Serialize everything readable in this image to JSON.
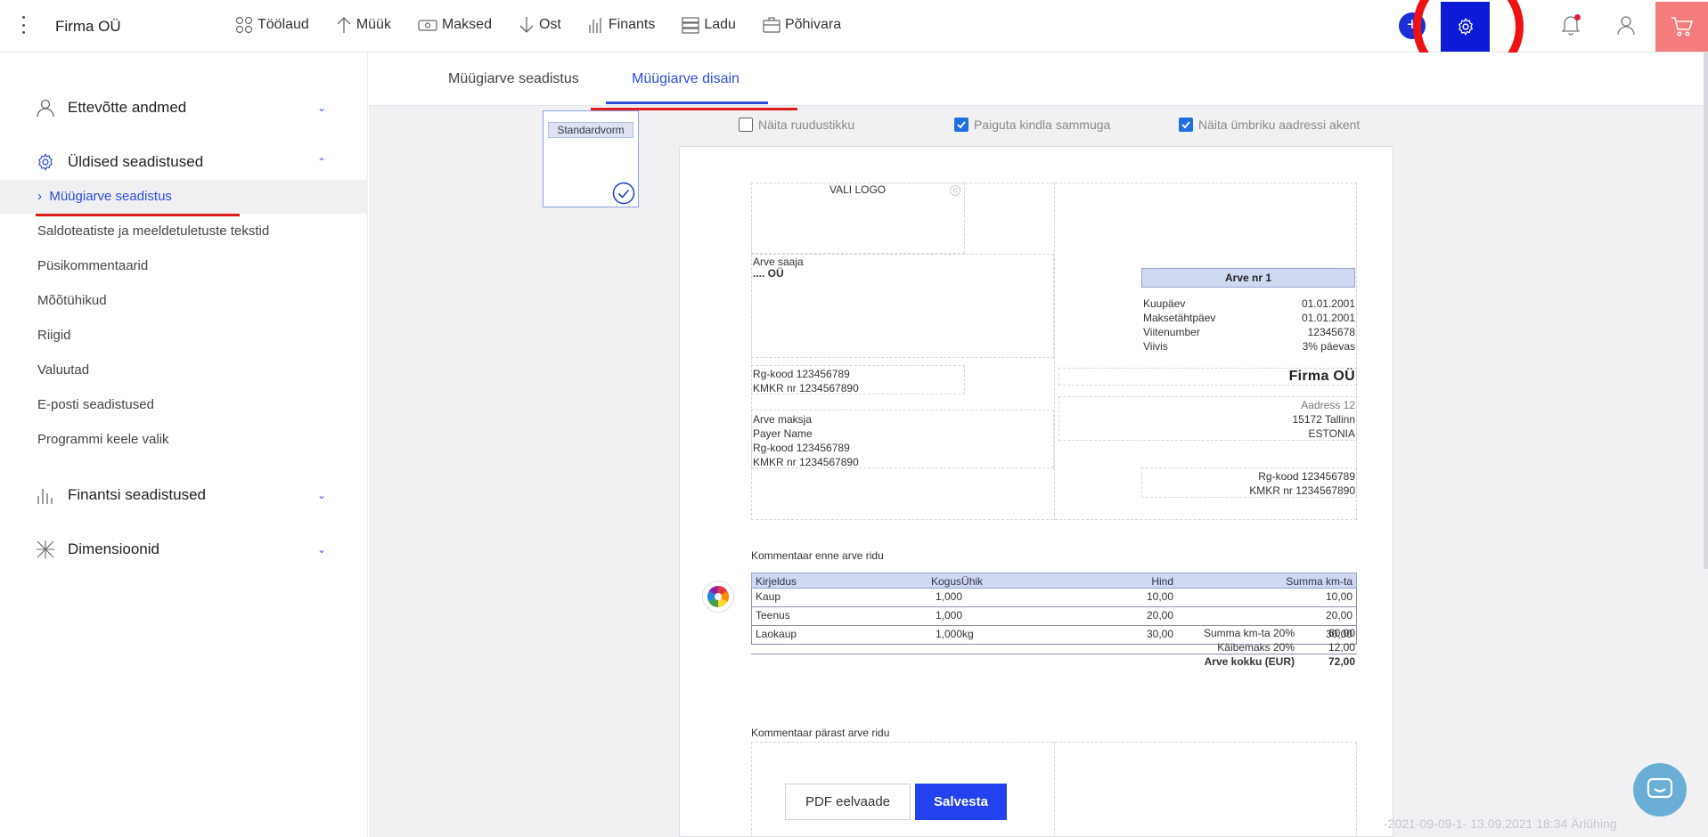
{
  "header": {
    "company": "Firma OÜ",
    "nav": [
      {
        "label": "Töölaud",
        "icon": "dashboard-icon"
      },
      {
        "label": "Müük",
        "icon": "arrow-up-icon"
      },
      {
        "label": "Maksed",
        "icon": "money-icon"
      },
      {
        "label": "Ost",
        "icon": "arrow-down-icon"
      },
      {
        "label": "Finants",
        "icon": "bar-chart-icon"
      },
      {
        "label": "Ladu",
        "icon": "warehouse-icon"
      },
      {
        "label": "Põhivara",
        "icon": "briefcase-icon"
      }
    ],
    "plus": "+"
  },
  "sidebar": {
    "sections": [
      {
        "label": "Ettevõtte andmed",
        "icon": "person-icon",
        "expanded": false
      },
      {
        "label": "Üldised seadistused",
        "icon": "gear-icon",
        "expanded": true
      },
      {
        "label": "Finantsi seadistused",
        "icon": "bar-chart-icon",
        "expanded": false
      },
      {
        "label": "Dimensioonid",
        "icon": "dimensions-icon",
        "expanded": false
      }
    ],
    "items": [
      "Müügiarve seadistus",
      "Saldoteatiste ja meeldetuletuste tekstid",
      "Püsikommentaarid",
      "Mõõtühikud",
      "Riigid",
      "Valuutad",
      "E-posti seadistused",
      "Programmi keele valik"
    ],
    "active_item": "Müügiarve seadistus"
  },
  "tabs": [
    "Müügiarve seadistus",
    "Müügiarve disain"
  ],
  "active_tab": "Müügiarve disain",
  "template": {
    "label": "Standardvorm"
  },
  "options": [
    {
      "label": "Näita ruudustikku",
      "checked": false
    },
    {
      "label": "Paiguta kindla sammuga",
      "checked": true
    },
    {
      "label": "Näita ümbriku aadressi akent",
      "checked": true
    }
  ],
  "invoice": {
    "logo": "VALI LOGO",
    "recipient_label": "Arve saaja",
    "recipient_name": "....  OÜ",
    "recipient_reg": "Rg-kood 123456789",
    "recipient_vat": "KMKR nr 1234567890",
    "payer_label": "Arve maksja",
    "payer_name": "Payer Name",
    "payer_reg": "Rg-kood 123456789",
    "payer_vat": "KMKR nr 1234567890",
    "invoice_title": "Arve nr 1",
    "details": [
      {
        "label": "Kuupäev",
        "value": "01.01.2001"
      },
      {
        "label": "Maksetähtpäev",
        "value": "01.01.2001"
      },
      {
        "label": "Viitenumber",
        "value": "12345678"
      },
      {
        "label": "Viivis",
        "value": "3% päevas"
      }
    ],
    "seller_name": "Firma OÜ",
    "seller_address": [
      "Aadress 12",
      "15172 Tallinn",
      "ESTONIA"
    ],
    "seller_reg": "Rg-kood 123456789",
    "seller_vat": "KMKR nr 1234567890",
    "comment_before": "Kommentaar enne arve ridu",
    "columns": [
      "Kirjeldus",
      "KogusÜhik",
      "Hind",
      "Summa km-ta"
    ],
    "rows": [
      [
        "Kaup",
        "1,000",
        "10,00",
        "10,00"
      ],
      [
        "Teenus",
        "1,000",
        "20,00",
        "20,00"
      ],
      [
        "Laokaup",
        "1,000kg",
        "30,00",
        "30,00"
      ]
    ],
    "totals": [
      {
        "label": "Summa km-ta 20%",
        "value": "60,00"
      },
      {
        "label": "Käibemaks 20%",
        "value": "12,00"
      },
      {
        "label": "Arve kokku (EUR)",
        "value": "72,00"
      }
    ],
    "comment_after": "Kommentaar pärast arve ridu"
  },
  "buttons": {
    "pdf": "PDF eelvaade",
    "save": "Salvesta"
  },
  "version": "-2021-09-09-1- 13.09.2021 18:34 Äriühing",
  "colors": {
    "accent": "#2d4be0",
    "highlight": "#e01d1d",
    "cart": "#f47c7c",
    "gear": "#0d1bd6"
  }
}
